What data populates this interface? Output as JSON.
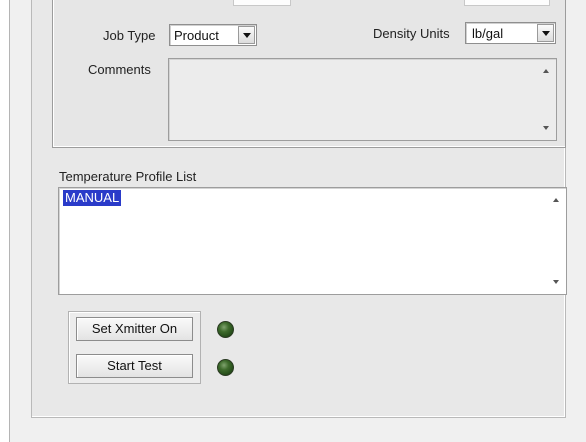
{
  "job_settings": {
    "job_type_label": "Job Type",
    "job_type_value": "Product",
    "density_units_label": "Density Units",
    "density_units_value": "lb/gal",
    "comments_label": "Comments",
    "comments_value": ""
  },
  "temperature_profile": {
    "label": "Temperature Profile List",
    "items": [
      "MANUAL"
    ],
    "selected": "MANUAL"
  },
  "controls": {
    "xmitter_button_label": "Set Xmitter On",
    "xmitter_led_state": "off",
    "start_test_button_label": "Start Test",
    "start_test_led_state": "off"
  },
  "colors": {
    "selection": "#2a3bc9",
    "led_off": "#3e6b2c",
    "panel_background": "#e6e6e6"
  },
  "icons": {
    "dropdown": "chevron-down-icon",
    "scroll_up": "scroll-up-arrow-icon",
    "scroll_down": "scroll-down-arrow-icon"
  }
}
